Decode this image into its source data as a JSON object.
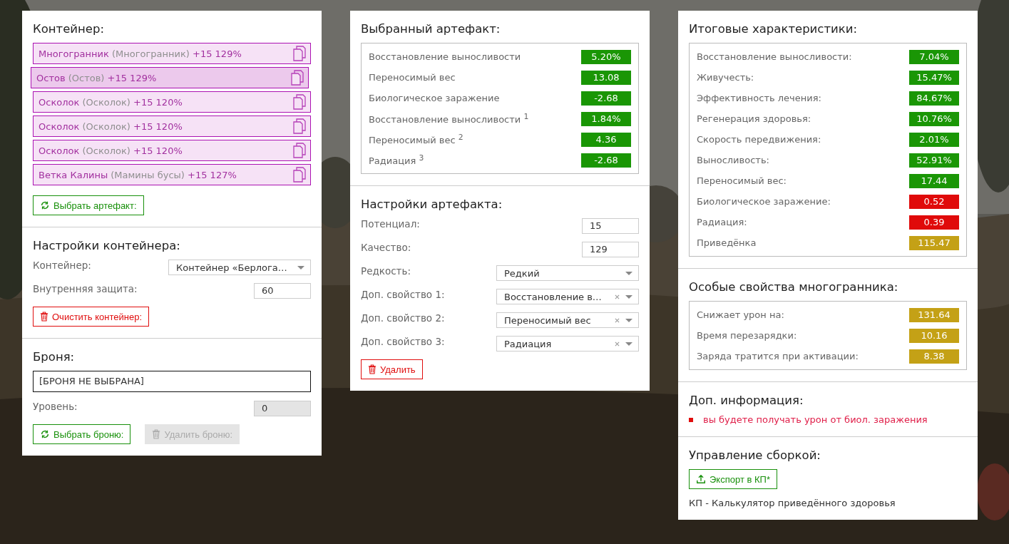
{
  "container": {
    "title": "Контейнер:",
    "artifacts": [
      {
        "name": "Многогранник",
        "variant": "(Многогранник)",
        "stats": "+15 129%",
        "selected": false
      },
      {
        "name": "Остов",
        "variant": "(Остов)",
        "stats": "+15 129%",
        "selected": true
      },
      {
        "name": "Осколок",
        "variant": "(Осколок)",
        "stats": "+15 120%",
        "selected": false
      },
      {
        "name": "Осколок",
        "variant": "(Осколок)",
        "stats": "+15 120%",
        "selected": false
      },
      {
        "name": "Осколок",
        "variant": "(Осколок)",
        "stats": "+15 120%",
        "selected": false
      },
      {
        "name": "Ветка Калины",
        "variant": "(Мамины бусы)",
        "stats": "+15 127%",
        "selected": false
      }
    ],
    "button": {
      "label": "Выбрать артефакт:",
      "kind": "select",
      "disabled": false
    }
  },
  "container_settings": {
    "title": "Настройки контейнера:",
    "fields": [
      {
        "label": "Контейнер:",
        "kind": "select",
        "value": "Контейнер «Берлога…",
        "disabled": false
      },
      {
        "label": "Внутренняя защита:",
        "kind": "number",
        "value": "60",
        "disabled": false
      }
    ],
    "button": {
      "label": "Очистить контейнер:",
      "kind": "clear",
      "disabled": false
    }
  },
  "armor": {
    "title": "Броня:",
    "value": "[БРОНЯ НЕ ВЫБРАНА]",
    "fields": [
      {
        "label": "Уровень:",
        "kind": "number",
        "value": "0",
        "disabled": true
      }
    ],
    "buttons": [
      {
        "label": "Выбрать броню:",
        "kind": "select",
        "disabled": false
      },
      {
        "label": "Удалить броню:",
        "kind": "clear",
        "disabled": true
      }
    ]
  },
  "selected_artifact": {
    "title": "Выбранный артефакт:",
    "stats": [
      {
        "label": "Восстановление выносливости",
        "value": "5.20%",
        "color": "#1a9605"
      },
      {
        "label": "Переносимый вес",
        "value": "13.08",
        "color": "#1a9605"
      },
      {
        "label": "Биологическое заражение",
        "value": "-2.68",
        "color": "#1a9605"
      },
      {
        "label": "Восстановление выносливости $^{1}$",
        "value": "1.84%",
        "color": "#1a9605"
      },
      {
        "label": "Переносимый вес $^{2}$",
        "value": "4.36",
        "color": "#1a9605"
      },
      {
        "label": "Радиация $^{3}$",
        "value": "-2.68",
        "color": "#1a9605"
      }
    ]
  },
  "artifact_settings": {
    "title": "Настройки артефакта:",
    "fields": [
      {
        "label": "Потенциал:",
        "kind": "number",
        "value": "15",
        "disabled": false
      },
      {
        "label": "Качество:",
        "kind": "number",
        "value": "129",
        "disabled": false
      },
      {
        "label": "Редкость:",
        "kind": "select",
        "value": "Редкий",
        "disabled": false
      },
      {
        "label": "Доп. свойство 1:",
        "kind": "clearable",
        "value": "Восстановление в…",
        "disabled": false
      },
      {
        "label": "Доп. свойство 2:",
        "kind": "clearable",
        "value": "Переносимый вес",
        "disabled": false
      },
      {
        "label": "Доп. свойство 3:",
        "kind": "clearable",
        "value": "Радиация",
        "disabled": false
      }
    ],
    "button": {
      "label": "Удалить",
      "kind": "clear",
      "disabled": false
    }
  },
  "totals": {
    "title": "Итоговые характеристики:",
    "stats": [
      {
        "label": "Восстановление выносливости:",
        "value": "7.04%",
        "color": "#1a9605"
      },
      {
        "label": "Живучесть:",
        "value": "15.47%",
        "color": "#1a9605"
      },
      {
        "label": "Эффективность лечения:",
        "value": "84.67%",
        "color": "#1a9605"
      },
      {
        "label": "Регенерация здоровья:",
        "value": "10.76%",
        "color": "#1a9605"
      },
      {
        "label": "Скорость передвижения:",
        "value": "2.01%",
        "color": "#1a9605"
      },
      {
        "label": "Выносливость:",
        "value": "52.91%",
        "color": "#1a9605"
      },
      {
        "label": "Переносимый вес:",
        "value": "17.44",
        "color": "#1a9605"
      },
      {
        "label": "Биологическое заражение:",
        "value": "0.52",
        "color": "#e00a0a"
      },
      {
        "label": "Радиация:",
        "value": "0.39",
        "color": "#e00a0a"
      },
      {
        "label": "Приведёнка",
        "value": "115.47",
        "color": "#c4a116"
      }
    ]
  },
  "polyhedron": {
    "title": "Особые свойства многогранника:",
    "stats": [
      {
        "label": "Снижает урон на:",
        "value": "131.64",
        "color": "#c4a116"
      },
      {
        "label": "Время перезарядки:",
        "value": "10.16",
        "color": "#c4a116"
      },
      {
        "label": "Заряда тратится при активации:",
        "value": "8.38",
        "color": "#c4a116"
      }
    ]
  },
  "info": {
    "title": "Доп. информация:",
    "messages": [
      "вы будете получать урон от биол. заражения"
    ]
  },
  "build": {
    "title": "Управление сборкой:",
    "button": {
      "label": "Экспорт в КП*",
      "kind": "export",
      "disabled": false
    },
    "note": "КП - Калькулятор приведённого здоровья"
  }
}
